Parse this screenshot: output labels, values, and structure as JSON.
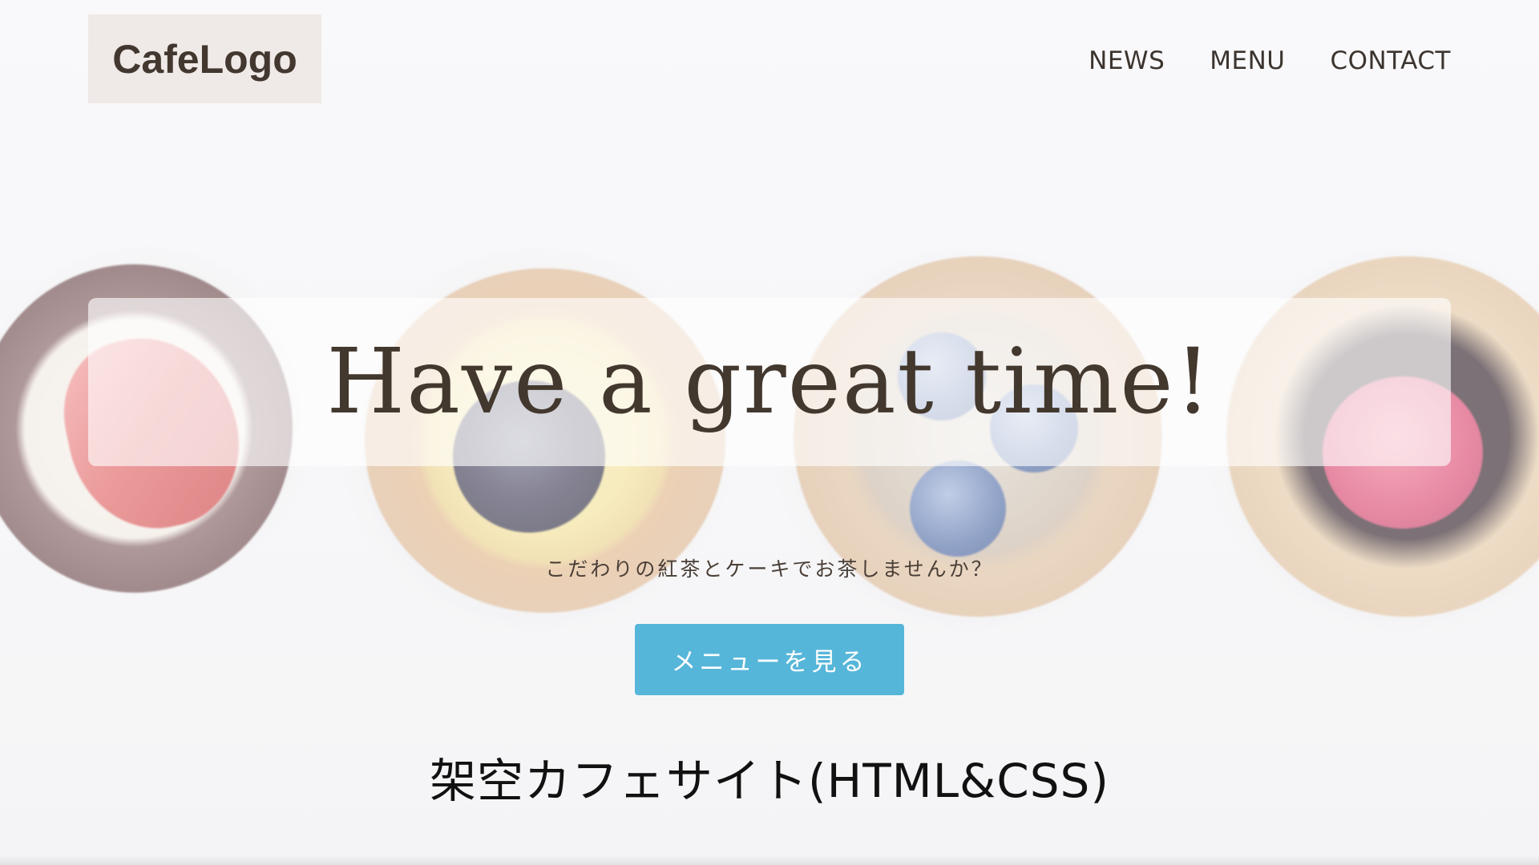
{
  "header": {
    "logo": "CafeLogo",
    "nav": [
      "NEWS",
      "MENU",
      "CONTACT"
    ]
  },
  "hero": {
    "headline": "Have a great time!",
    "tagline": "こだわりの紅茶とケーキでお茶しませんか？",
    "cta_label": "メニューを見る"
  },
  "caption": "架空カフェサイト(HTML&CSS)",
  "colors": {
    "accent": "#56b6d9",
    "text_brown": "#43382e",
    "logo_bg": "#efe9e7"
  }
}
